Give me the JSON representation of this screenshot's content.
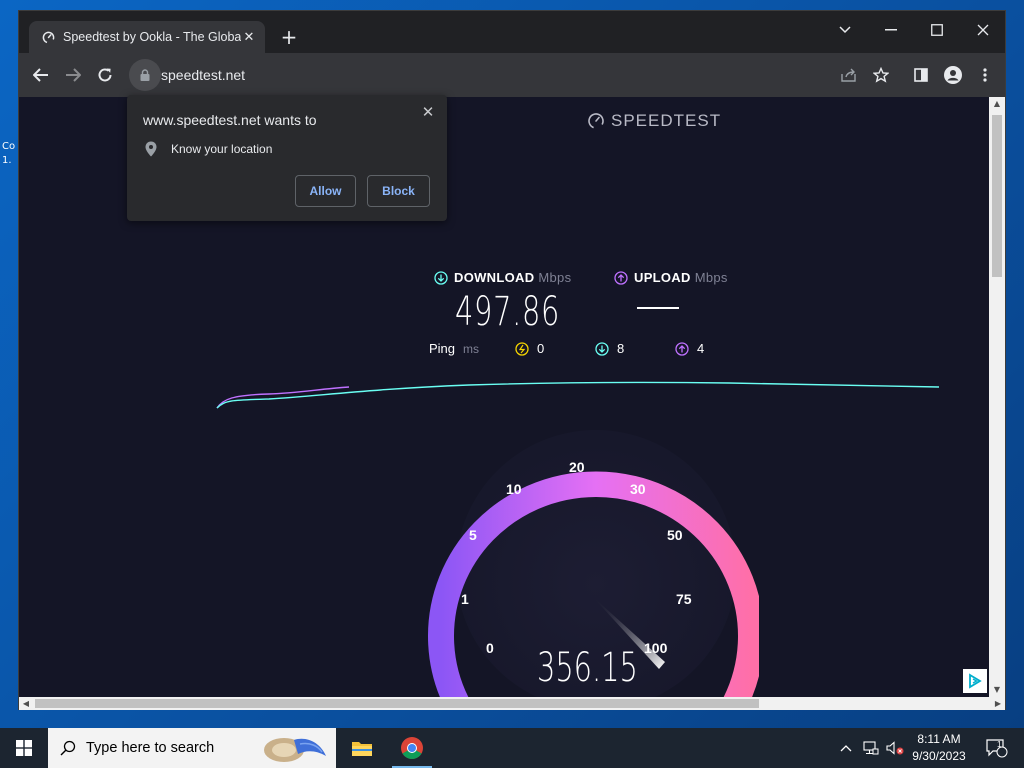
{
  "desktop": {
    "icon_label": "Co 1."
  },
  "browser": {
    "tab_title": "Speedtest by Ookla - The Global",
    "url": "speedtest.net"
  },
  "permission_prompt": {
    "title": "www.speedtest.net wants to",
    "request": "Know your location",
    "allow_label": "Allow",
    "block_label": "Block"
  },
  "speedtest": {
    "brand": "SPEEDTEST",
    "download_label": "DOWNLOAD",
    "download_unit": "Mbps",
    "download_value": "497.86",
    "upload_label": "UPLOAD",
    "upload_unit": "Mbps",
    "ping_label": "Ping",
    "ping_unit": "ms",
    "ping_idle": "0",
    "ping_download": "8",
    "ping_upload": "4",
    "gauge_ticks": [
      "0",
      "1",
      "5",
      "10",
      "20",
      "30",
      "50",
      "75",
      "100"
    ],
    "gauge_value": "356.15",
    "colors": {
      "download": "#6afff3",
      "upload": "#bf71ff",
      "ping": "#f5d400",
      "gauge_start": "#8c56f5",
      "gauge_end": "#ff6fa8"
    }
  },
  "taskbar": {
    "search_placeholder": "Type here to search",
    "time": "8:11 AM",
    "date": "9/30/2023",
    "notification_count": "1"
  }
}
